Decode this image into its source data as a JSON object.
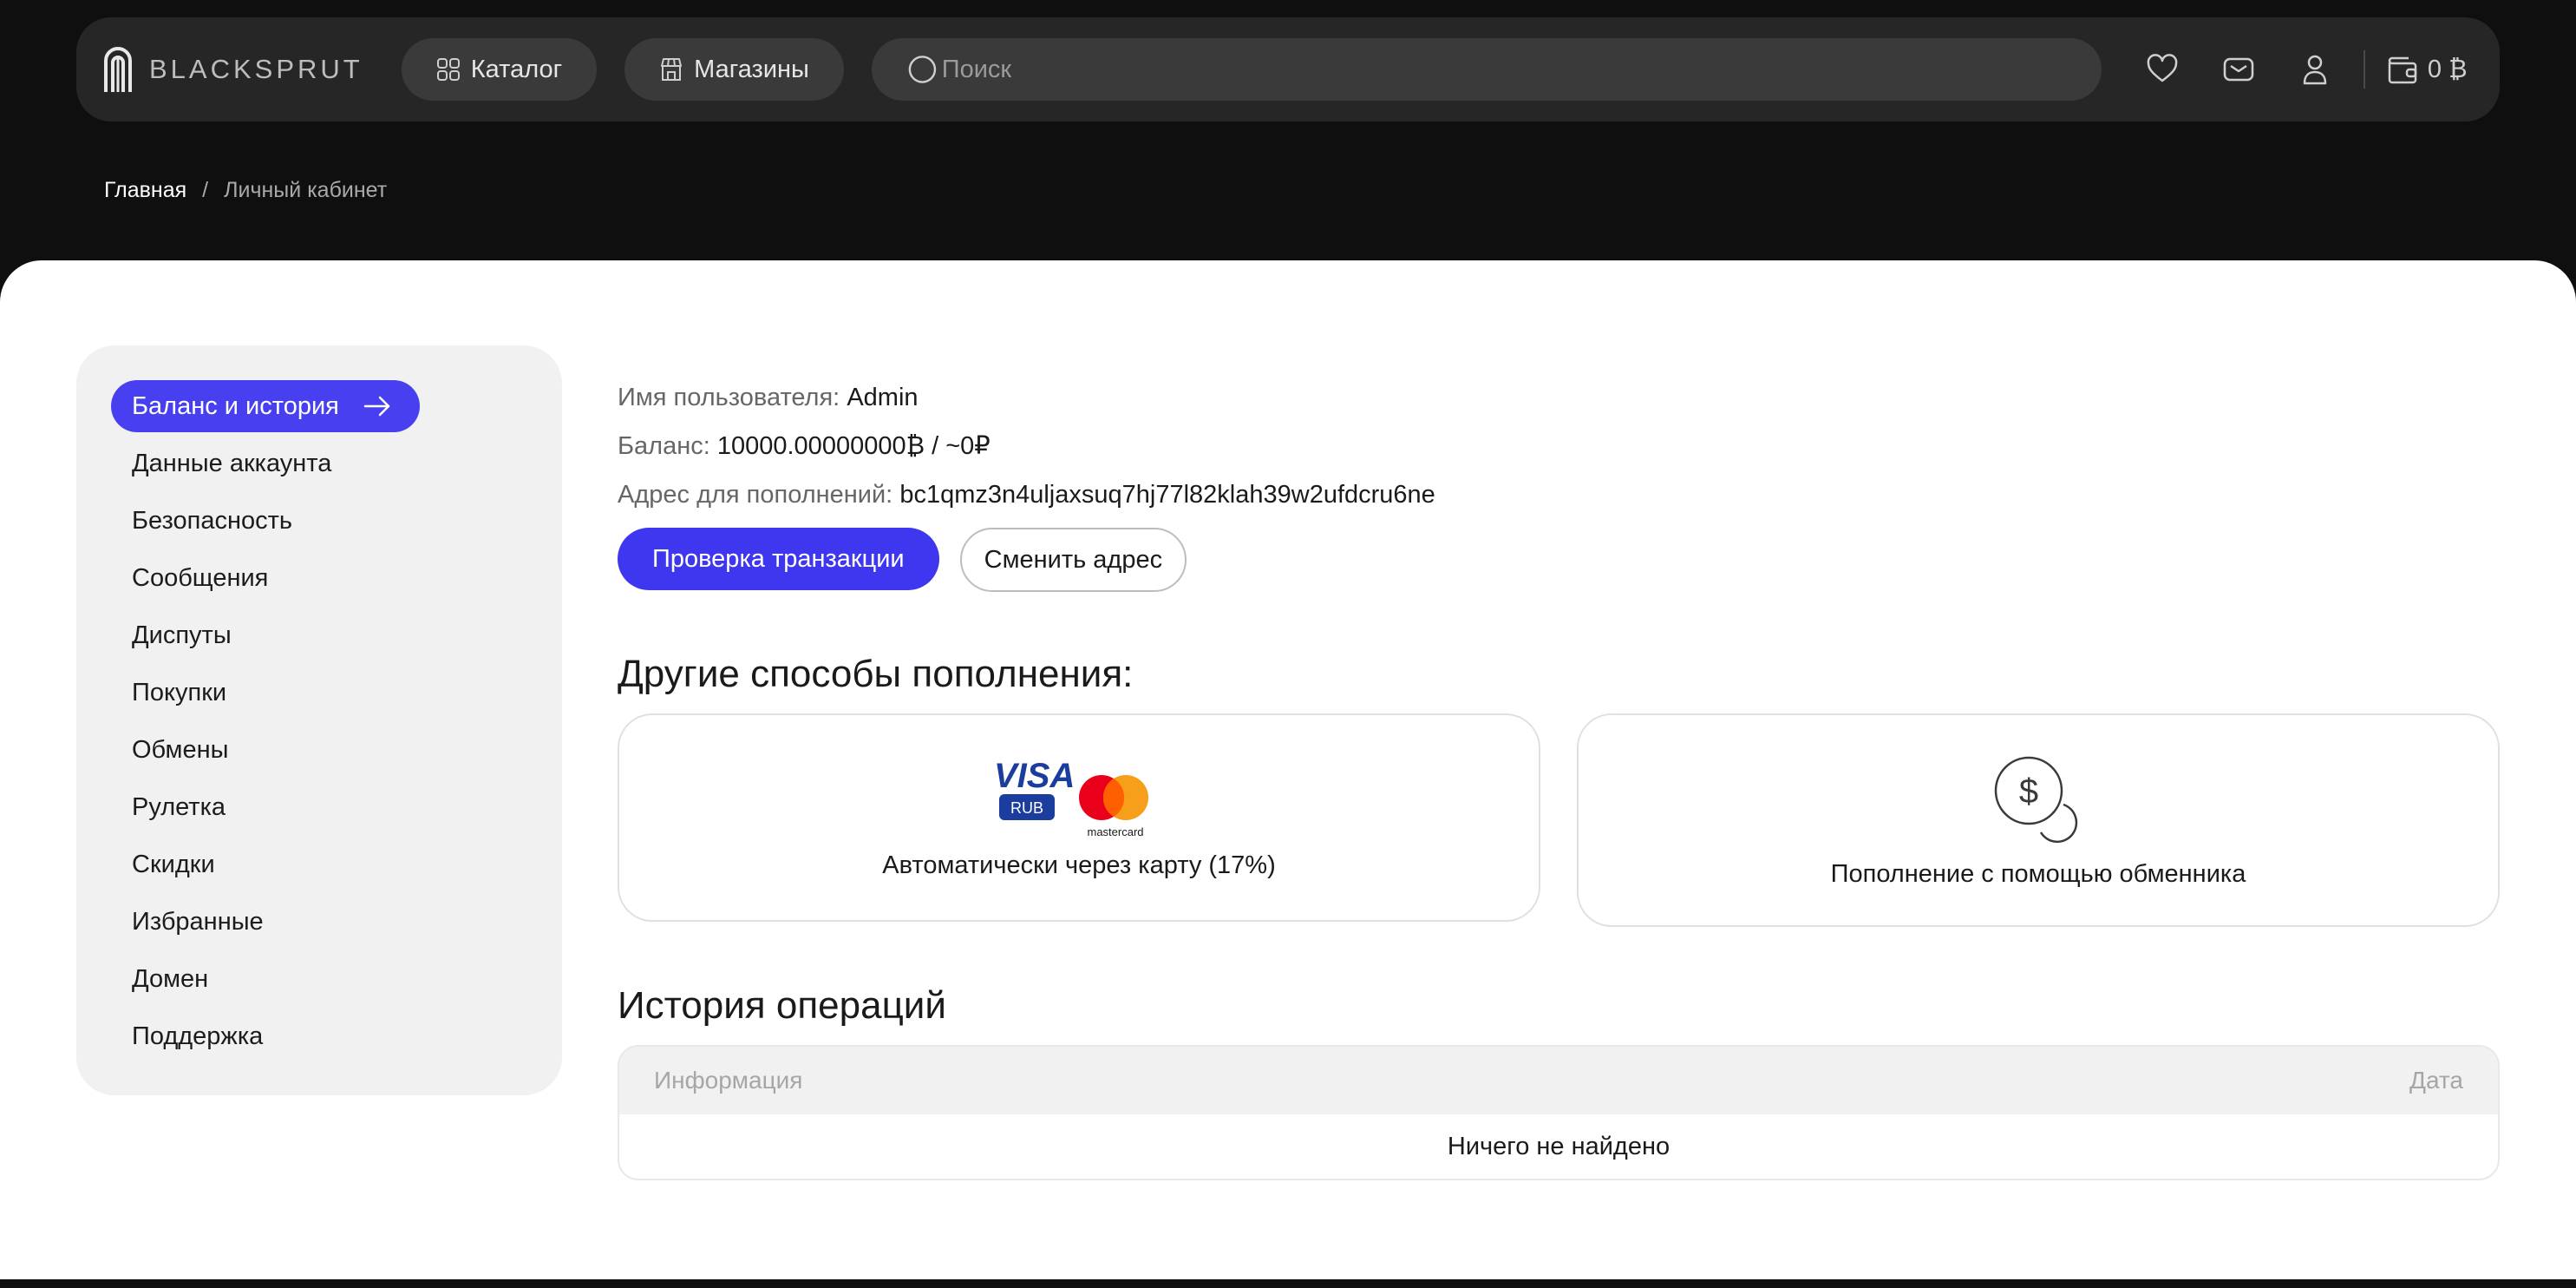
{
  "header": {
    "logo_text": "BLACKSPRUT",
    "catalog_label": "Каталог",
    "shops_label": "Магазины",
    "search_placeholder": "Поиск",
    "wallet_amount": "0 ₿",
    "icons": [
      "favorites-icon",
      "messages-icon",
      "profile-icon",
      "wallet-icon"
    ]
  },
  "breadcrumb": {
    "home": "Главная",
    "separator": "/",
    "current": "Личный кабинет"
  },
  "sidebar": {
    "items": [
      {
        "label": "Баланс и история",
        "active": true
      },
      {
        "label": "Данные аккаунта"
      },
      {
        "label": "Безопасность"
      },
      {
        "label": "Сообщения"
      },
      {
        "label": "Диспуты"
      },
      {
        "label": "Покупки"
      },
      {
        "label": "Обмены"
      },
      {
        "label": "Рулетка"
      },
      {
        "label": "Скидки"
      },
      {
        "label": "Избранные"
      },
      {
        "label": "Домен"
      },
      {
        "label": "Поддержка"
      }
    ]
  },
  "account": {
    "username_label": "Имя пользователя:",
    "username": "Admin",
    "balance_label": "Баланс:",
    "balance": "10000.00000000₿ / ~0₽",
    "address_label": "Адрес для пополнений:",
    "address": "bc1qmz3n4uljaxsuq7hj77l82klah39w2ufdcru6ne",
    "check_tx_button": "Проверка транзакции",
    "change_address_button": "Сменить адрес"
  },
  "methods": {
    "title": "Другие способы пополнения:",
    "card": {
      "visa_text": "VISA",
      "rub_text": "RUB",
      "mastercard_text": "mastercard",
      "label": "Автоматически через карту (17%)"
    },
    "exchange": {
      "label": "Пополнение с помощью обменника"
    }
  },
  "history": {
    "title": "История операций",
    "col_info": "Информация",
    "col_date": "Дата",
    "empty": "Ничего не найдено"
  },
  "colors": {
    "accent": "#3f37f0",
    "accent_active": "#4840f0",
    "header_bg": "#262626",
    "page_bg": "#0f0f0f"
  }
}
